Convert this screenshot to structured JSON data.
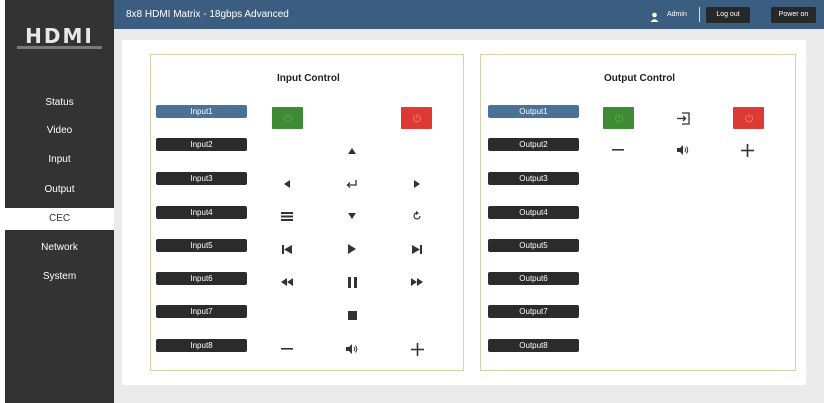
{
  "brand": {
    "logo_text": "HDMI",
    "accent": "#3b5e80",
    "power_on_color": "#3f8a34",
    "power_off_color": "#dd3a35"
  },
  "header": {
    "title": "8x8 HDMI Matrix - 18gbps Advanced",
    "user_label": "Admin",
    "logout_label": "Log out",
    "power_label": "Power on"
  },
  "sidebar": {
    "items": [
      {
        "label": "Status",
        "active": false
      },
      {
        "label": "Video",
        "active": false
      },
      {
        "label": "Input",
        "active": false
      },
      {
        "label": "Output",
        "active": false
      },
      {
        "label": "CEC",
        "active": true
      },
      {
        "label": "Network",
        "active": false
      },
      {
        "label": "System",
        "active": false
      }
    ]
  },
  "input_control": {
    "title": "Input Control",
    "selected": "Input1",
    "ports": [
      "Input1",
      "Input2",
      "Input3",
      "Input4",
      "Input5",
      "Input6",
      "Input7",
      "Input8"
    ],
    "controls": [
      "power-on",
      "power-off",
      "up",
      "left",
      "enter",
      "right",
      "menu",
      "down",
      "back",
      "previous",
      "play",
      "next",
      "rewind",
      "pause",
      "fast-forward",
      "stop",
      "volume-down",
      "mute",
      "volume-up"
    ]
  },
  "output_control": {
    "title": "Output Control",
    "selected": "Output1",
    "ports": [
      "Output1",
      "Output2",
      "Output3",
      "Output4",
      "Output5",
      "Output6",
      "Output7",
      "Output8"
    ],
    "controls": [
      "power-on",
      "source",
      "power-off",
      "volume-down",
      "mute",
      "volume-up"
    ]
  }
}
